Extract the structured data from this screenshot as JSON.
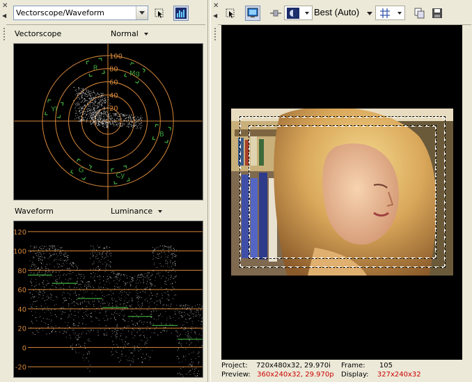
{
  "left_panel": {
    "selector_value": "Vectorscope/Waveform",
    "vectorscope": {
      "label": "Vectorscope",
      "mode": "Normal",
      "rings": [
        "20",
        "40",
        "60",
        "80",
        "100"
      ],
      "targets": [
        "R",
        "Mg",
        "B",
        "Cy",
        "G",
        "Yl"
      ]
    },
    "waveform": {
      "label": "Waveform",
      "mode": "Luminance",
      "scale": [
        "120",
        "100",
        "80",
        "60",
        "40",
        "20",
        "0",
        "-20"
      ]
    }
  },
  "right_panel": {
    "quality": "Best (Auto)"
  },
  "status": {
    "project_label": "Project:",
    "project_value": "720x480x32, 29.970i",
    "preview_label": "Preview:",
    "preview_res": "360x240x32",
    "preview_sep": ",",
    "preview_rate": "29.970p",
    "frame_label": "Frame:",
    "frame_value": "105",
    "display_label": "Display:",
    "display_value": "327x240x32"
  },
  "colors": {
    "scope_lines": "#d9893a",
    "target_green": "#3ca33c",
    "status_red": "#cc0000",
    "toolbar_bg": "#ece9d8"
  },
  "icons": [
    "pin-icon",
    "gripper-icon",
    "select-cursor-icon",
    "histogram-icon",
    "monitor-icon",
    "split-view-icon",
    "preview-mode-icon",
    "grid-overlay-icon",
    "copy-snapshot-icon",
    "save-snapshot-icon"
  ]
}
